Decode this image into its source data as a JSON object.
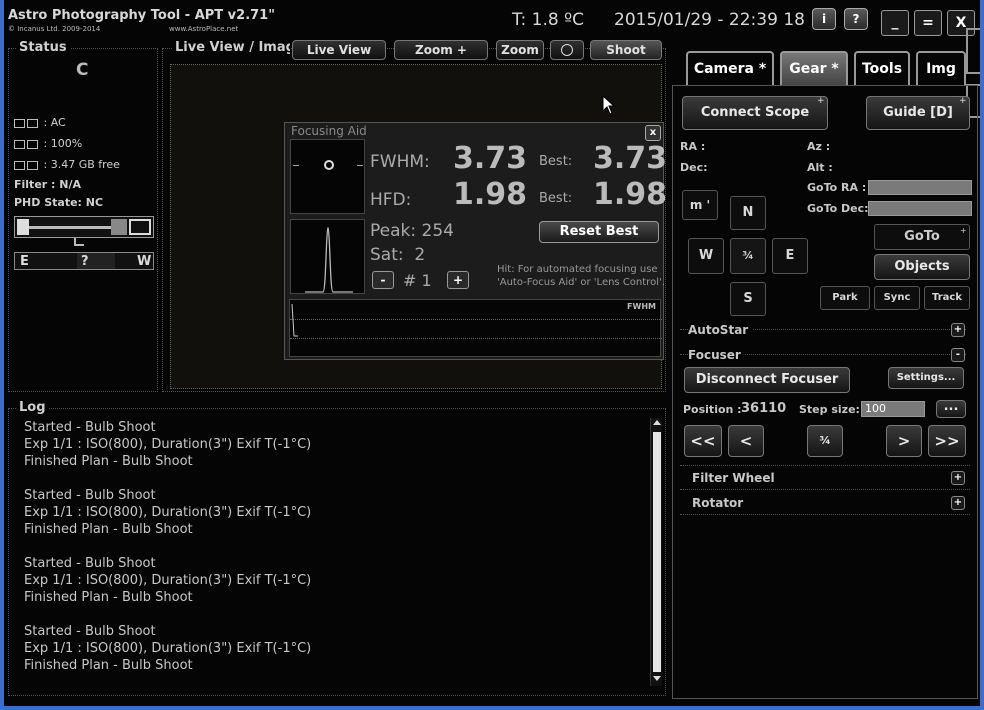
{
  "app": {
    "title": "Astro Photography Tool - APT v2.71\"",
    "copyright": "© Incanus Ltd. 2009-2014",
    "website": "www.AstroPlace.net",
    "temperature": "T: 1.8 ºC",
    "datetime": "2015/01/29 - 22:39 18",
    "info_label": "i",
    "help_label": "?",
    "minimize_label": "_",
    "maximize_label": "=",
    "close_label": "X"
  },
  "status": {
    "title": "Status",
    "connection_letter": "C",
    "power": ": AC",
    "battery": ": 100%",
    "storage": ": 3.47 GB free",
    "filter": "Filter : N/A",
    "phd_state": "PHD State: NC",
    "compass_e": "E",
    "compass_q": "?",
    "compass_w": "W"
  },
  "liveview": {
    "title": "Live View / Imag",
    "live_view_label": "Live View",
    "zoom_in_label": "Zoom +",
    "zoom_out_label": "Zoom -",
    "shoot_label": "Shoot"
  },
  "focusing_aid": {
    "title": "Focusing Aid",
    "close_label": "x",
    "fwhm_label": "FWHM:",
    "fwhm_value": "3.73",
    "fwhm_best_label": "Best:",
    "fwhm_best_value": "3.73",
    "hfd_label": "HFD:",
    "hfd_value": "1.98",
    "hfd_best_label": "Best:",
    "hfd_best_value": "1.98",
    "peak": "Peak: 254",
    "sat": "Sat:  2",
    "reset_label": "Reset Best",
    "minus_label": "-",
    "counter": "# 1",
    "plus_label": "+",
    "hint_line1": "Hit: For automated focusing use",
    "hint_line2": "'Auto-Focus Aid' or 'Lens Control'.",
    "graph_label": "FWHM"
  },
  "log": {
    "title": "Log",
    "lines": [
      "Started - Bulb Shoot",
      "Exp 1/1 : ISO(800), Duration(3\") Exif T(-1°C)",
      "Finished Plan - Bulb Shoot",
      "",
      "Started - Bulb Shoot",
      "Exp 1/1 : ISO(800), Duration(3\") Exif T(-1°C)",
      "Finished Plan - Bulb Shoot",
      "",
      "Started - Bulb Shoot",
      "Exp 1/1 : ISO(800), Duration(3\") Exif T(-1°C)",
      "Finished Plan - Bulb Shoot",
      "",
      "Started - Bulb Shoot",
      "Exp 1/1 : ISO(800), Duration(3\") Exif T(-1°C)",
      "Finished Plan - Bulb Shoot"
    ]
  },
  "tabs": {
    "camera": "Camera *",
    "gear": "Gear *",
    "tools": "Tools",
    "img": "Img"
  },
  "gear": {
    "connect_scope": "Connect Scope",
    "guide": "Guide [D]",
    "ra": "RA :",
    "dec": "Dec:",
    "az": "Az :",
    "alt": "Alt :",
    "goto_ra": "GoTo RA :",
    "goto_dec": "GoTo Dec:",
    "rate": "m '",
    "north": "N",
    "west": "W",
    "center": "¾",
    "east": "E",
    "south": "S",
    "goto": "GoTo",
    "objects": "Objects",
    "park": "Park",
    "sync": "Sync",
    "track": "Track",
    "autostar": "AutoStar",
    "focuser": "Focuser",
    "disconnect_focuser": "Disconnect Focuser",
    "settings": "Settings...",
    "position_label": "Position :",
    "position_value": "36110",
    "step_size_label": "Step size:",
    "step_size_value": "100",
    "more": "...",
    "fast_in": "<<",
    "in": "<",
    "focus_center": "¾",
    "out": ">",
    "fast_out": ">>",
    "filter_wheel": "Filter Wheel",
    "rotator": "Rotator",
    "expand_plus": "+",
    "collapse_minus": "-",
    "corner_plus": "+"
  }
}
